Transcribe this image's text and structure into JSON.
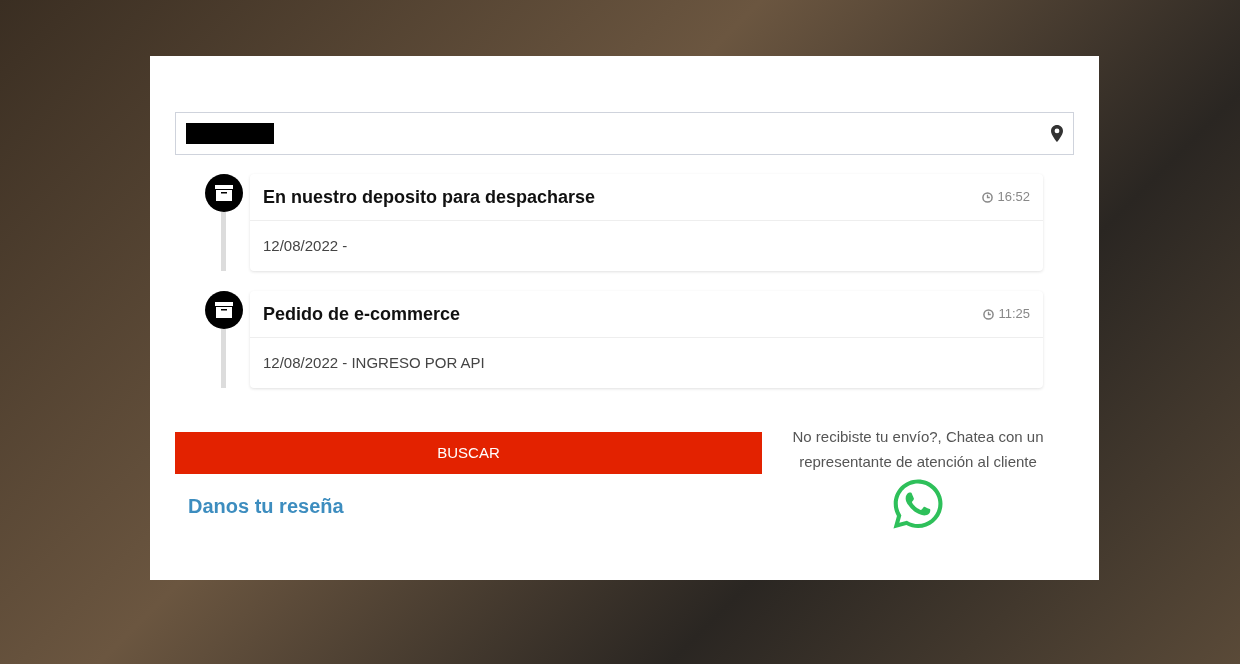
{
  "events": [
    {
      "title": "En nuestro deposito para despacharse",
      "time": "16:52",
      "detail": "12/08/2022 -"
    },
    {
      "title": "Pedido de e-commerce",
      "time": "11:25",
      "detail": "12/08/2022 - INGRESO POR API"
    }
  ],
  "search_button": "BUSCAR",
  "review_link": "Danos tu reseña",
  "help_text": "No recibiste tu envío?, Chatea con un representante de atención al cliente"
}
